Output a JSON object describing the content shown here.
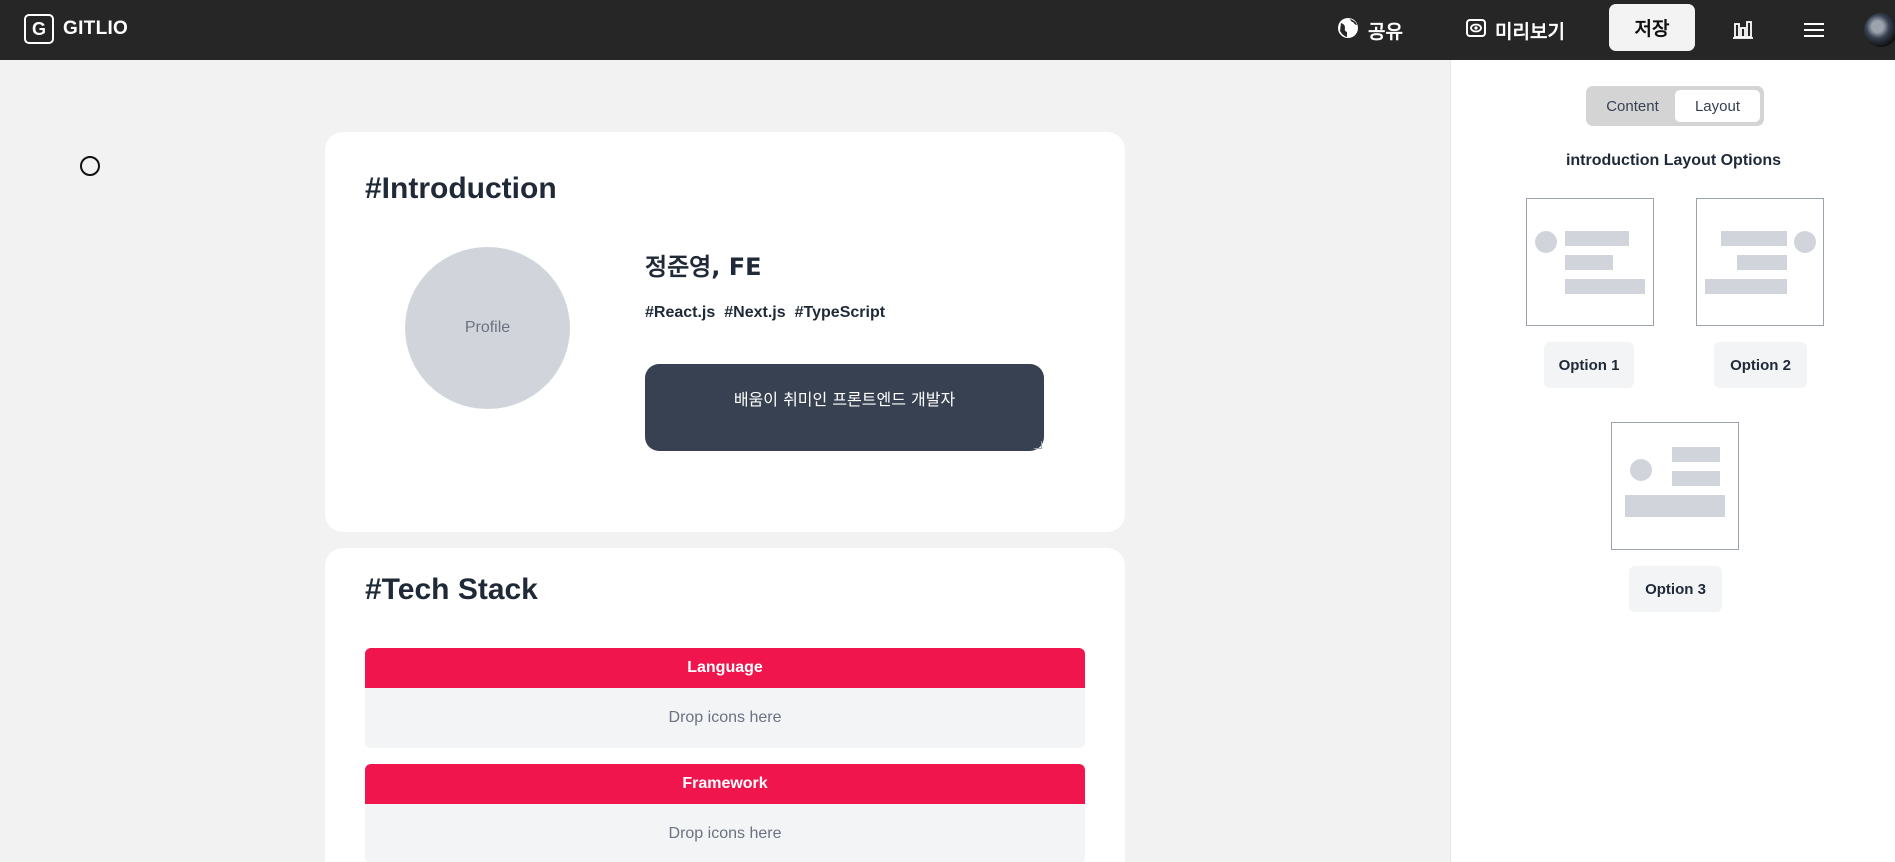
{
  "header": {
    "logo_letter": "G",
    "brand": "GITLIO",
    "share_label": "공유",
    "preview_label": "미리보기",
    "save_label": "저장"
  },
  "introduction": {
    "title": "#Introduction",
    "profile_label": "Profile",
    "name": "정준영, FE",
    "tags": [
      "#React.js",
      "#Next.js",
      "#TypeScript"
    ],
    "bio": "배움이 취미인 프론트엔드 개발자"
  },
  "tech_stack": {
    "title": "#Tech Stack",
    "sections": [
      {
        "heading": "Language",
        "placeholder": "Drop icons here"
      },
      {
        "heading": "Framework",
        "placeholder": "Drop icons here"
      }
    ]
  },
  "panel": {
    "tabs": [
      {
        "label": "Content",
        "active": false
      },
      {
        "label": "Layout",
        "active": true
      }
    ],
    "title": "introduction Layout Options",
    "options": [
      "Option 1",
      "Option 2",
      "Option 3"
    ]
  },
  "colors": {
    "topbar": "#262626",
    "accent": "#f0154d",
    "bio_bg": "#374151"
  }
}
